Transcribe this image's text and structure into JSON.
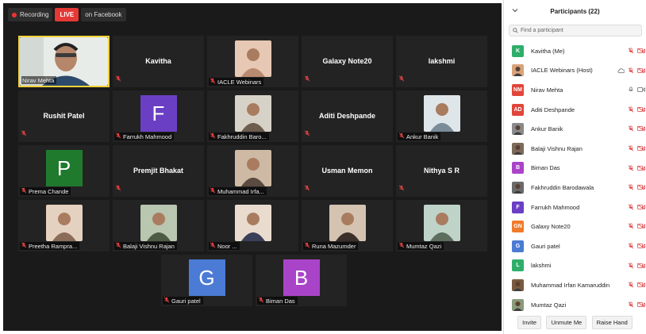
{
  "topbar": {
    "recording": "Recording",
    "live": "LIVE",
    "destination": "on Facebook"
  },
  "tiles": [
    {
      "type": "video",
      "label": "Nirav Mehta",
      "active": true
    },
    {
      "type": "name",
      "name": "Kavitha"
    },
    {
      "type": "video",
      "label": "IACLE Webinars"
    },
    {
      "type": "name",
      "name": "Galaxy Note20"
    },
    {
      "type": "name",
      "name": "lakshmi"
    },
    {
      "type": "name",
      "name": "Rushit Patel"
    },
    {
      "type": "avatar",
      "letter": "F",
      "label": "Farrukh Mahmood",
      "color": "#6a3fc4"
    },
    {
      "type": "video",
      "label": "Fakhruddin Baro..."
    },
    {
      "type": "name",
      "name": "Aditi Deshpande"
    },
    {
      "type": "video",
      "label": "Ankur Banik"
    },
    {
      "type": "avatar",
      "letter": "P",
      "label": "Prema Chande",
      "color": "#1f7a2e"
    },
    {
      "type": "name",
      "name": "Premjit Bhakat"
    },
    {
      "type": "video",
      "label": "Muhammad Irfa..."
    },
    {
      "type": "name",
      "name": "Usman Memon"
    },
    {
      "type": "name",
      "name": "Nithya S R"
    },
    {
      "type": "video",
      "label": "Preetha Rampra..."
    },
    {
      "type": "video",
      "label": "Balaji Vishnu Rajan"
    },
    {
      "type": "video",
      "label": "Noor ..."
    },
    {
      "type": "video",
      "label": "Runa Mazumder"
    },
    {
      "type": "video",
      "label": "Mumtaz Qazi"
    },
    {
      "type": "avatar",
      "letter": "G",
      "label": "Gauri patel",
      "color": "#4b7bd4"
    },
    {
      "type": "avatar",
      "letter": "B",
      "label": "Biman Das",
      "color": "#a944c9"
    }
  ],
  "panel": {
    "title": "Participants (22)",
    "search_placeholder": "Find a participant",
    "participants": [
      {
        "name": "Kavitha (Me)",
        "initials": "K",
        "color": "#2fae6a",
        "photo": false,
        "mic": "muted"
      },
      {
        "name": "IACLE Webinars (Host)",
        "initials": "",
        "color": "#d9a37a",
        "photo": true,
        "mic": "muted",
        "cloud": true
      },
      {
        "name": "Nirav Mehta",
        "initials": "NM",
        "color": "#e0463a",
        "photo": false,
        "mic": "on"
      },
      {
        "name": "Aditi Deshpande",
        "initials": "AD",
        "color": "#e0463a",
        "photo": false,
        "mic": "muted"
      },
      {
        "name": "Ankur Banik",
        "initials": "",
        "color": "#8a8a8a",
        "photo": true,
        "mic": "muted"
      },
      {
        "name": "Balaji Vishnu Rajan",
        "initials": "",
        "color": "#7d6a5a",
        "photo": true,
        "mic": "muted"
      },
      {
        "name": "Biman Das",
        "initials": "B",
        "color": "#a944c9",
        "photo": false,
        "mic": "muted"
      },
      {
        "name": "Fakhruddin Barodawala",
        "initials": "",
        "color": "#6b6b6b",
        "photo": true,
        "mic": "muted"
      },
      {
        "name": "Farrukh Mahmood",
        "initials": "F",
        "color": "#6a3fc4",
        "photo": false,
        "mic": "muted"
      },
      {
        "name": "Galaxy Note20",
        "initials": "GN",
        "color": "#f07a2a",
        "photo": false,
        "mic": "muted"
      },
      {
        "name": "Gauri patel",
        "initials": "G",
        "color": "#4b7bd4",
        "photo": false,
        "mic": "muted"
      },
      {
        "name": "lakshmi",
        "initials": "L",
        "color": "#2fae6a",
        "photo": false,
        "mic": "muted"
      },
      {
        "name": "Muhammad Irfan Kamaruddin",
        "initials": "",
        "color": "#7a5a3f",
        "photo": true,
        "mic": "muted"
      },
      {
        "name": "Mumtaz Qazi",
        "initials": "",
        "color": "#8a9a7a",
        "photo": true,
        "mic": "muted"
      }
    ],
    "buttons": {
      "invite": "Invite",
      "unmute": "Unmute Me",
      "raise_hand": "Raise Hand"
    }
  }
}
